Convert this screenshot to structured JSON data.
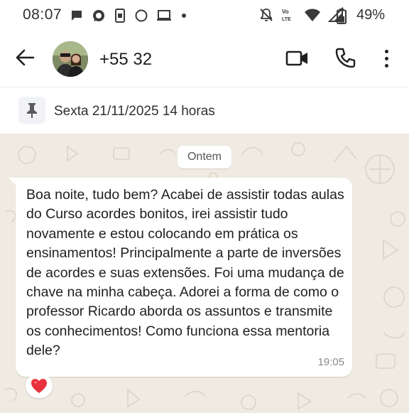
{
  "status_bar": {
    "time": "08:07",
    "battery_percent": "49%",
    "left_icons": [
      "message-icon",
      "whatsapp-icon",
      "phone-screen-icon",
      "circle-icon",
      "laptop-icon",
      "dot-icon"
    ],
    "right_icons": [
      "mute-icon",
      "volte-icon",
      "wifi-icon",
      "signal-icon",
      "battery-icon"
    ]
  },
  "header": {
    "contact_name": "+55 32",
    "icons": [
      "back-arrow-icon",
      "video-call-icon",
      "voice-call-icon",
      "more-options-icon"
    ]
  },
  "pinned": {
    "text": "Sexta 21/11/2025 14 horas",
    "icon": "pin-icon"
  },
  "chat": {
    "date_divider": "Ontem",
    "messages": [
      {
        "text": "Boa noite, tudo bem? Acabei de assistir todas aulas do Curso acordes bonitos, irei assistir tudo novamente e estou colocando em prática os ensinamentos! Principalmente a parte de inversões de acordes e suas extensões. Foi uma mudança de chave na minha cabeça. Adorei a forma de como o professor Ricardo aborda os assuntos e transmite os conhecimentos! Como funciona essa mentoria dele?",
        "time": "19:05",
        "reaction": "❤️"
      }
    ]
  },
  "colors": {
    "chat_background": "#efeae2",
    "bubble": "#ffffff",
    "reaction_heart": "#e8313b"
  }
}
